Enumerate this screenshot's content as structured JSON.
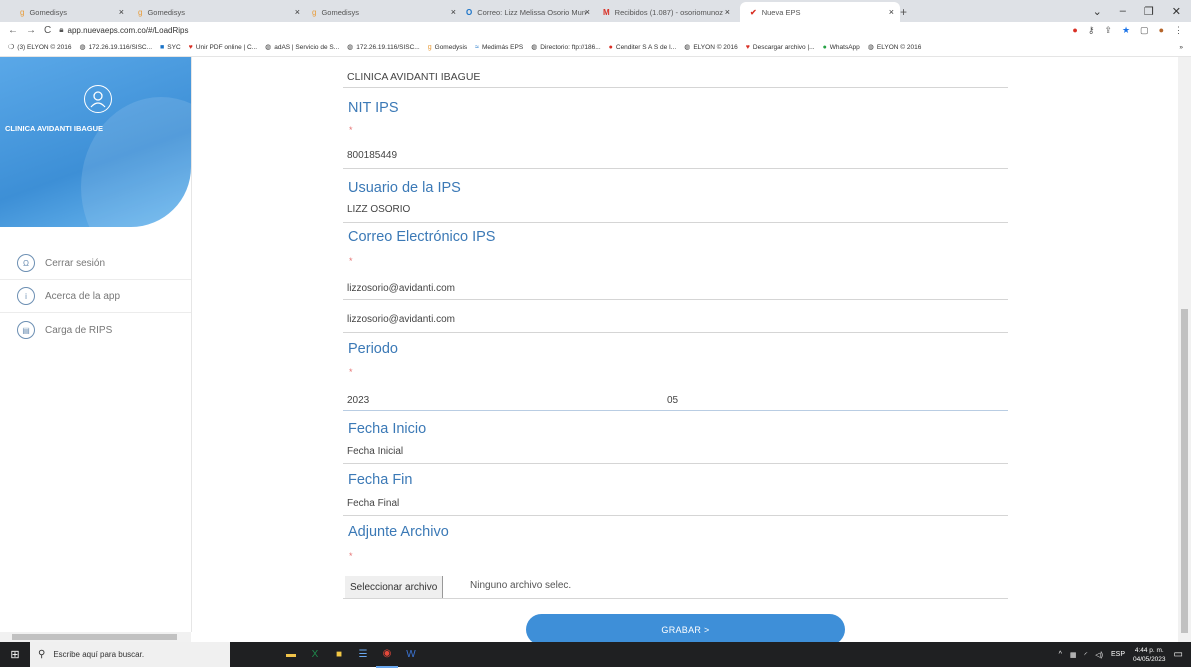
{
  "browser": {
    "tabs": [
      {
        "title": "Gomedisys",
        "icon": "g",
        "active": false
      },
      {
        "title": "Gomedisys",
        "icon": "g",
        "active": false
      },
      {
        "title": "Gomedisys",
        "icon": "g",
        "active": false
      },
      {
        "title": "Correo: Lizz Melissa Osorio Mun",
        "icon": "O",
        "active": false
      },
      {
        "title": "Recibidos (1.087) - osoriomunoz",
        "icon": "M",
        "active": false
      },
      {
        "title": "Nueva EPS",
        "icon": "✔",
        "active": true
      }
    ],
    "new_tab": "+",
    "url": "app.nuevaeps.com.co/#/LoadRips",
    "bookmarks": [
      "(3) ELYON © 2016",
      "172.26.19.116/SISC...",
      "SYC",
      "Unir PDF online | C...",
      "adAS | Servicio de S...",
      "172.26.19.116/SISC...",
      "Gomedysis",
      "Medimás EPS",
      "Directorio: ftp://186...",
      "Cenditer S A S de I...",
      "ELYON © 2016",
      "Descargar archivo |...",
      "WhatsApp",
      "ELYON © 2016"
    ],
    "bookmarks_more": "»"
  },
  "sidebar": {
    "clinic_name": "CLINICA AVIDANTI IBAGUE",
    "menu": [
      {
        "label": "Cerrar sesión",
        "icon": "Ω"
      },
      {
        "label": "Acerca de la app",
        "icon": "i"
      },
      {
        "label": "Carga de RIPS",
        "icon": "▤"
      }
    ]
  },
  "form": {
    "ips_name_value": "CLINICA AVIDANTI IBAGUE",
    "nit_label": "NIT IPS",
    "required_mark": "*",
    "nit_value": "800185449",
    "user_label": "Usuario de la IPS",
    "user_value": "LIZZ OSORIO",
    "email_label": "Correo Electrónico IPS",
    "email_value": "lizzosorio@avidanti.com",
    "email_confirm_value": "lizzosorio@avidanti.com",
    "period_label": "Periodo",
    "period_year": "2023",
    "period_month": "05",
    "start_label": "Fecha Inicio",
    "start_placeholder": "Fecha Inicial",
    "end_label": "Fecha Fin",
    "end_placeholder": "Fecha Final",
    "attach_label": "Adjunte Archivo",
    "file_button": "Seleccionar archivo",
    "file_status": "Ninguno archivo selec.",
    "submit": "GRABAR >"
  },
  "taskbar": {
    "search_placeholder": "Escribe aquí para buscar.",
    "lang": "ESP",
    "time": "4:44 p. m.",
    "date": "04/05/2023"
  },
  "colors": {
    "accent": "#3e8fd8",
    "label": "#3b79b6",
    "required": "#e57373"
  }
}
